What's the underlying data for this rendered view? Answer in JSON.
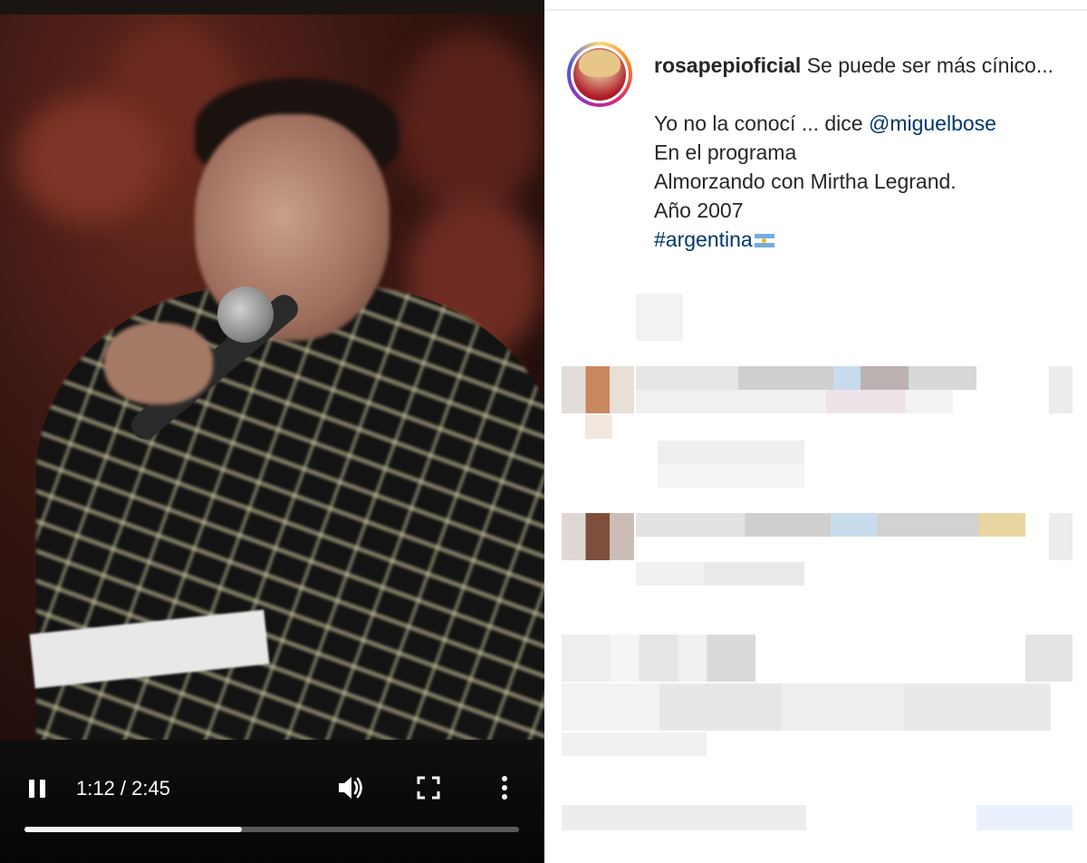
{
  "video": {
    "time_display": "1:12 / 2:45",
    "progress_fraction": 0.44,
    "icons": {
      "pause": "pause-icon",
      "volume": "volume-icon",
      "fullscreen": "fullscreen-icon",
      "more": "more-vertical-icon"
    }
  },
  "post": {
    "username": "rosapepioficial",
    "caption_first": "Se puede ser más cínico...",
    "line_conoci": "Yo no la conocí ... dice ",
    "mention": "@miguelbose",
    "line_programa": "En el programa",
    "line_almorzando": "Almorzando con Mirtha Legrand.",
    "line_anio": "Año 2007",
    "hashtag": "#argentina",
    "flag_icon": "argentina-flag-icon"
  },
  "colors": {
    "link": "#00376b",
    "text": "#262626",
    "video_bg": "#0d0d0d"
  }
}
